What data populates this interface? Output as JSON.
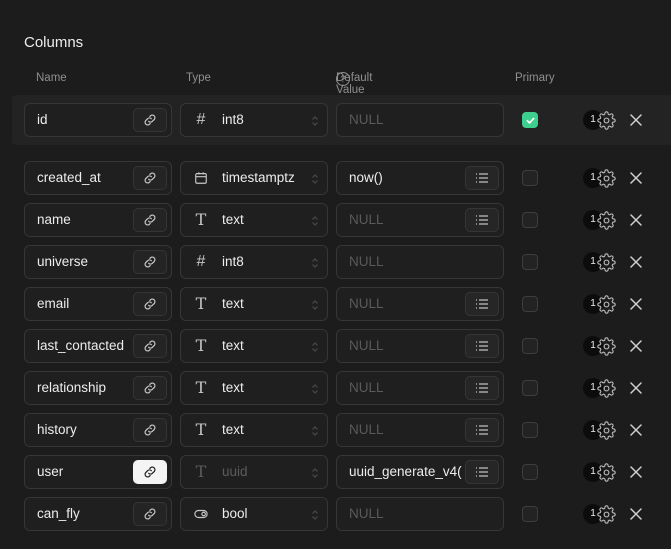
{
  "section_title": "Columns",
  "headers": {
    "name": "Name",
    "type": "Type",
    "default_value": "Default Value",
    "help": "?",
    "primary": "Primary"
  },
  "colors": {
    "background": "#1c1c1c",
    "primary_check": "#3ecf8e",
    "placeholder": "#5a5a5a"
  },
  "rows": [
    {
      "name": "id",
      "type": "int8",
      "type_icon": "hash-icon",
      "default": "",
      "default_placeholder": "NULL",
      "has_list_button": false,
      "primary": true,
      "link_active": false,
      "type_muted": false,
      "badge": "1"
    },
    {
      "name": "created_at",
      "type": "timestamptz",
      "type_icon": "calendar-icon",
      "default": "now()",
      "default_placeholder": "NULL",
      "has_list_button": true,
      "primary": false,
      "link_active": false,
      "type_muted": false,
      "badge": "1"
    },
    {
      "name": "name",
      "type": "text",
      "type_icon": "text-type-icon",
      "default": "",
      "default_placeholder": "NULL",
      "has_list_button": true,
      "primary": false,
      "link_active": false,
      "type_muted": false,
      "badge": "1"
    },
    {
      "name": "universe",
      "type": "int8",
      "type_icon": "hash-icon",
      "default": "",
      "default_placeholder": "NULL",
      "has_list_button": false,
      "primary": false,
      "link_active": false,
      "type_muted": false,
      "badge": "1"
    },
    {
      "name": "email",
      "type": "text",
      "type_icon": "text-type-icon",
      "default": "",
      "default_placeholder": "NULL",
      "has_list_button": true,
      "primary": false,
      "link_active": false,
      "type_muted": false,
      "badge": "1"
    },
    {
      "name": "last_contacted",
      "type": "text",
      "type_icon": "text-type-icon",
      "default": "",
      "default_placeholder": "NULL",
      "has_list_button": true,
      "primary": false,
      "link_active": false,
      "type_muted": false,
      "badge": "1"
    },
    {
      "name": "relationship",
      "type": "text",
      "type_icon": "text-type-icon",
      "default": "",
      "default_placeholder": "NULL",
      "has_list_button": true,
      "primary": false,
      "link_active": false,
      "type_muted": false,
      "badge": "1"
    },
    {
      "name": "history",
      "type": "text",
      "type_icon": "text-type-icon",
      "default": "",
      "default_placeholder": "NULL",
      "has_list_button": true,
      "primary": false,
      "link_active": false,
      "type_muted": false,
      "badge": "1"
    },
    {
      "name": "user",
      "type": "uuid",
      "type_icon": "text-type-icon",
      "default": "uuid_generate_v4(",
      "default_placeholder": "NULL",
      "has_list_button": true,
      "primary": false,
      "link_active": true,
      "type_muted": true,
      "badge": "1"
    },
    {
      "name": "can_fly",
      "type": "bool",
      "type_icon": "toggle-icon",
      "default": "",
      "default_placeholder": "NULL",
      "has_list_button": false,
      "primary": false,
      "link_active": false,
      "type_muted": false,
      "badge": "1"
    }
  ]
}
